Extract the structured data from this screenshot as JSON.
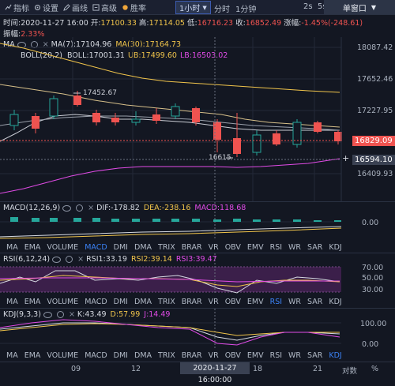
{
  "toolbar": {
    "items": [
      "指标",
      "设置",
      "画线",
      "高级",
      "胜率"
    ],
    "interval": "1小时",
    "interval2": "分时",
    "interval3": "1分钟",
    "right1": "2s",
    "right2": "5s",
    "ticker": "单窗口"
  },
  "info": {
    "time": "时间:2020-11-27 16:00",
    "open_label": "开:",
    "open": "17100.33",
    "high_label": "高:",
    "high": "17114.05",
    "low_label": "低:",
    "low": "16716.23",
    "close_label": "收:",
    "close": "16852.49",
    "change_label": "涨幅:",
    "change": "-1.45%(-248.61)",
    "amp_label": "振幅:",
    "amp": "2.33%"
  },
  "main_indicators": {
    "ma_name": "MA",
    "ma7": "MA(7):17104.96",
    "ma30": "MA(30):17164.73",
    "boll_name": "BOLL(20,2)",
    "boll": "BOLL:17001.31",
    "ub": "UB:17499.60",
    "lb": "LB:16503.02"
  },
  "main_axis": [
    "18087.42",
    "17652.46",
    "17227.95",
    "16409.93"
  ],
  "price_current": "16829.09",
  "price_cursor": "16594.10",
  "annot_high": "17452.67",
  "annot_low": "16615",
  "macd": {
    "name": "MACD(12,26,9)",
    "dif": "DIF:-178.82",
    "dea": "DEA:-238.16",
    "macd": "MACD:118.68",
    "axis": "0.00"
  },
  "tabs": [
    "MA",
    "EMA",
    "VOLUME",
    "MACD",
    "DMI",
    "DMA",
    "TRIX",
    "BRAR",
    "VR",
    "OBV",
    "EMV",
    "RSI",
    "WR",
    "SAR",
    "KDJ"
  ],
  "rsi": {
    "name": "RSI(6,12,24)",
    "r1": "RSI1:33.19",
    "r2": "RSI2:39.14",
    "r3": "RSI3:39.47",
    "axis": [
      "50.00",
      "30.00"
    ],
    "axis_top": "70.00"
  },
  "kdj": {
    "name": "KDJ(9,3,3)",
    "k": "K:43.49",
    "d": "D:57.99",
    "j": "J:14.49",
    "axis": [
      "100.00",
      "0.00"
    ]
  },
  "xaxis": [
    "09",
    "12",
    "18",
    "21"
  ],
  "x_cursor": "2020-11-27 16:00:00",
  "x_right": "对数",
  "x_pct": "%",
  "colors": {
    "bg": "#131722",
    "up": "#26a69a",
    "down": "#ef5350",
    "accent": "#3b82f6",
    "ma30": "#f0c44b",
    "boll_lb": "#e04be6"
  }
}
